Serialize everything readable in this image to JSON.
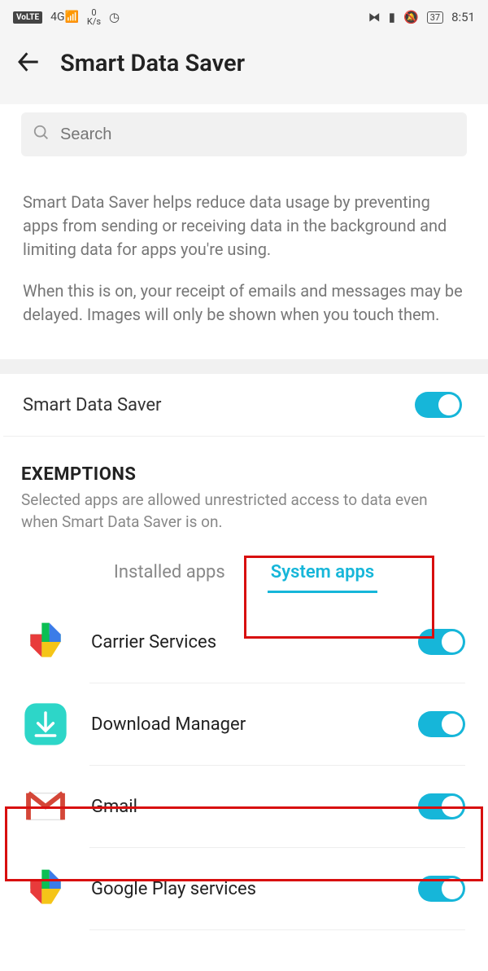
{
  "status": {
    "volte": "VoLTE",
    "sig": "4G",
    "kbs_top": "0",
    "kbs_bot": "K/s",
    "battery": "37",
    "time": "8:51"
  },
  "header": {
    "title": "Smart Data Saver"
  },
  "search": {
    "placeholder": "Search"
  },
  "description": {
    "p1": "Smart Data Saver helps reduce data usage by preventing apps from sending or receiving data in the background and limiting data for apps you're using.",
    "p2": "When this is on, your receipt of emails and messages may be delayed. Images will only be shown when you touch them."
  },
  "main_toggle": {
    "label": "Smart Data Saver",
    "on": true
  },
  "exemptions": {
    "title": "EXEMPTIONS",
    "subtitle": "Selected apps are allowed unrestricted access to data even when Smart Data Saver is on.",
    "tabs": {
      "installed": "Installed apps",
      "system": "System apps",
      "active": "system"
    }
  },
  "apps": [
    {
      "name": "Carrier Services",
      "on": true
    },
    {
      "name": "Download Manager",
      "on": true
    },
    {
      "name": "Gmail",
      "on": true
    },
    {
      "name": "Google Play services",
      "on": true
    }
  ]
}
